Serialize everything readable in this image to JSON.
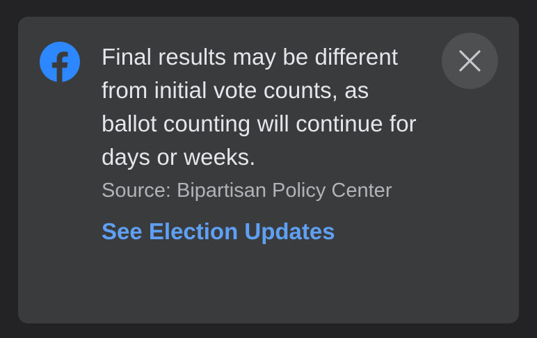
{
  "notice": {
    "logo_icon": "facebook-logo-icon",
    "message": "Final results may be different from initial vote counts, as ballot counting will continue for days or weeks.",
    "source": "Source: Bipartisan Policy Center",
    "cta_label": "See Election Updates",
    "close_icon": "close-icon"
  },
  "colors": {
    "card_background": "#3a3b3c",
    "page_background": "#232325",
    "brand_blue": "#2d88ff",
    "link_blue": "#5fa0f5",
    "close_button_background": "#4e4f50"
  }
}
